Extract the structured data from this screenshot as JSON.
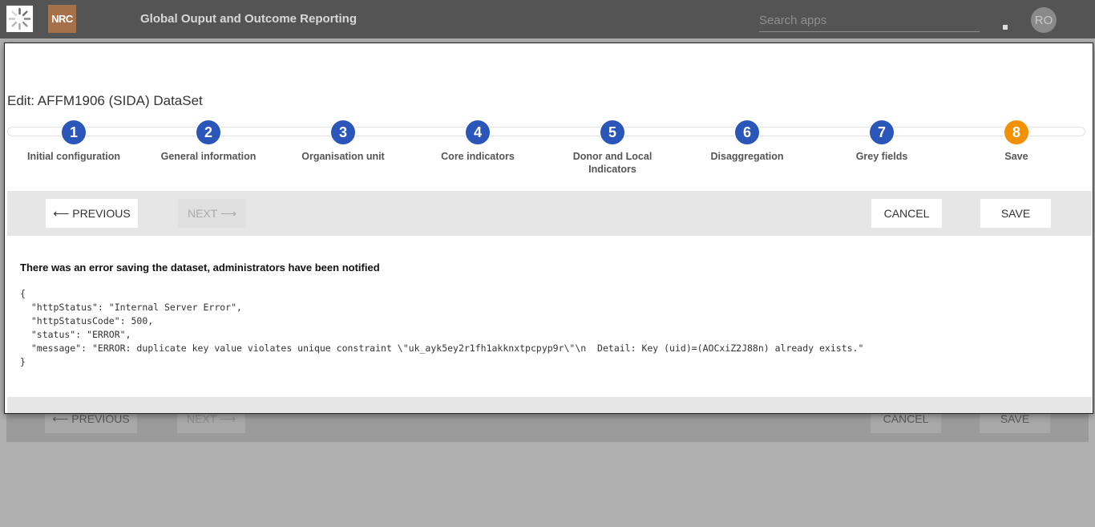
{
  "header": {
    "logo_text": "NRC",
    "app_title": "Global Ouput and Outcome Reporting",
    "search_placeholder": "Search apps",
    "avatar_initials": "RO"
  },
  "dialog": {
    "title": "Edit: AFFM1906 (SIDA) DataSet",
    "steps": [
      {
        "number": "1",
        "label": "Initial configuration"
      },
      {
        "number": "2",
        "label": "General information"
      },
      {
        "number": "3",
        "label": "Organisation unit"
      },
      {
        "number": "4",
        "label": "Core indicators"
      },
      {
        "number": "5",
        "label": "Donor and Local Indicators"
      },
      {
        "number": "6",
        "label": "Disaggregation"
      },
      {
        "number": "7",
        "label": "Grey fields"
      },
      {
        "number": "8",
        "label": "Save"
      }
    ],
    "active_step": 8,
    "buttons": {
      "previous": "⟵ PREVIOUS",
      "next": "NEXT ⟶",
      "cancel": "CANCEL",
      "save": "SAVE"
    },
    "error_title": "There was an error saving the dataset, administrators have been notified",
    "error_json": "{\n  \"httpStatus\": \"Internal Server Error\",\n  \"httpStatusCode\": 500,\n  \"status\": \"ERROR\",\n  \"message\": \"ERROR: duplicate key value violates unique constraint \\\"uk_ayk5ey2r1fh1akknxtpcpyp9r\\\"\\n  Detail: Key (uid)=(AOCxiZ2J88n) already exists.\"\n}"
  },
  "colors": {
    "header_bg": "#545454",
    "step_blue": "#2a56b9",
    "step_active_orange": "#f29106",
    "toolbar_bg": "#e6e6e6"
  }
}
